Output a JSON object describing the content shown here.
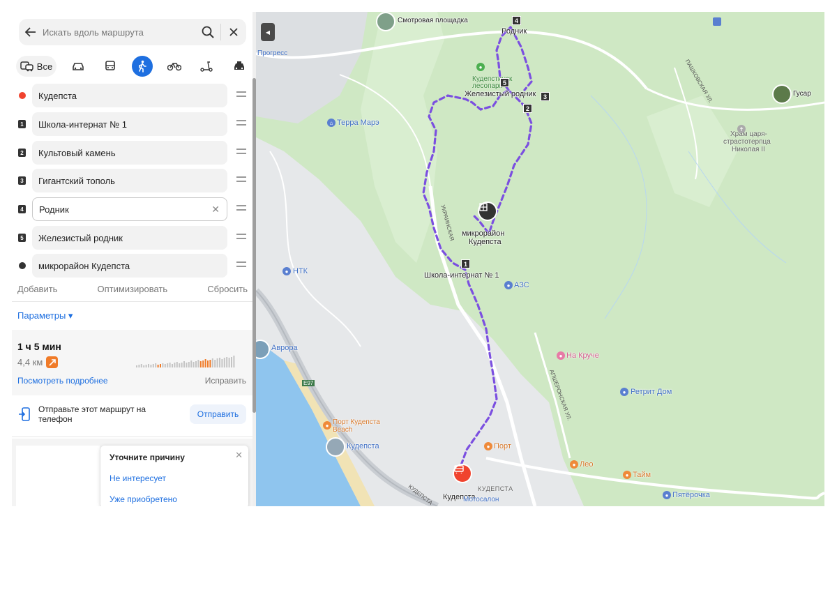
{
  "search": {
    "placeholder": "Искать вдоль маршрута"
  },
  "modes": {
    "all_label": "Все",
    "active": "pedestrian"
  },
  "points": [
    {
      "label": "Кудепста",
      "marker": "start",
      "color": "#f0432e"
    },
    {
      "label": "Школа-интернат № 1",
      "marker": "1"
    },
    {
      "label": "Культовый камень",
      "marker": "2"
    },
    {
      "label": "Гигантский тополь",
      "marker": "3"
    },
    {
      "label": "Родник",
      "marker": "4",
      "focused": true
    },
    {
      "label": "Железистый родник",
      "marker": "5"
    },
    {
      "label": "микрорайон Кудепста",
      "marker": "end",
      "color": "#333333"
    }
  ],
  "actions": {
    "add": "Добавить",
    "optimize": "Оптимизировать",
    "reset": "Сбросить"
  },
  "params_label": "Параметры ▾",
  "route": {
    "time": "1 ч 5 мин",
    "distance": "4,4 км",
    "details_link": "Посмотреть подробнее",
    "fix_link": "Исправить"
  },
  "send": {
    "text": "Отправьте этот маршрут на телефон",
    "button": "Отправить"
  },
  "feedback": {
    "title": "Уточните причину",
    "option1": "Не интересует",
    "option2": "Уже приобретено"
  },
  "map_labels": {
    "viewpoint": "Смотровая площадка",
    "spring": "Родник",
    "park": "Кудепстинский лесопарк",
    "park_line1": "Кудепстинск",
    "park_line2": "лесопарк",
    "iron_spring": "Железистый родник",
    "terra": "Терра Марэ",
    "progress": "Прогресс",
    "gusar": "Гусар",
    "temple_1": "Храм царя-",
    "temple_2": "страстотерпца",
    "temple_3": "Николая II",
    "district_1": "микрорайон",
    "district_2": "Кудепста",
    "school": "Школа-интернат № 1",
    "ntk": "НТК",
    "azs": "АЗС",
    "aurora": "Аврора",
    "na_kruche": "На Круче",
    "retreat": "Ретрит Дом",
    "port_beach_1": "Порт Кудепста",
    "port_beach_2": "Beach",
    "kudepsta_beach": "Кудепста",
    "port": "Порт",
    "leo": "Лео",
    "taim": "Тайм",
    "pyaterochka": "Пятёрочка",
    "kudepsta_caps": "КУДЕПСТА",
    "kudepsta_station": "Кудепста",
    "motosalon": "Мотосалон",
    "e97": "E97",
    "road_apsh": "АПШЕРОНСКАЯ УЛ.",
    "road_kud": "КУДЕПСТА",
    "road_pash": "ПАШКОВСКАЯ УЛ.",
    "road_ukr": "УКРАИНСКАЯ"
  },
  "map_markers": {
    "m1": "1",
    "m2": "2",
    "m3": "3",
    "m4": "4",
    "m5": "5"
  },
  "colors": {
    "accent": "#1e6fe0",
    "route": "#7b4fe0",
    "start": "#f0432e",
    "forest": "#cfe8c4"
  }
}
